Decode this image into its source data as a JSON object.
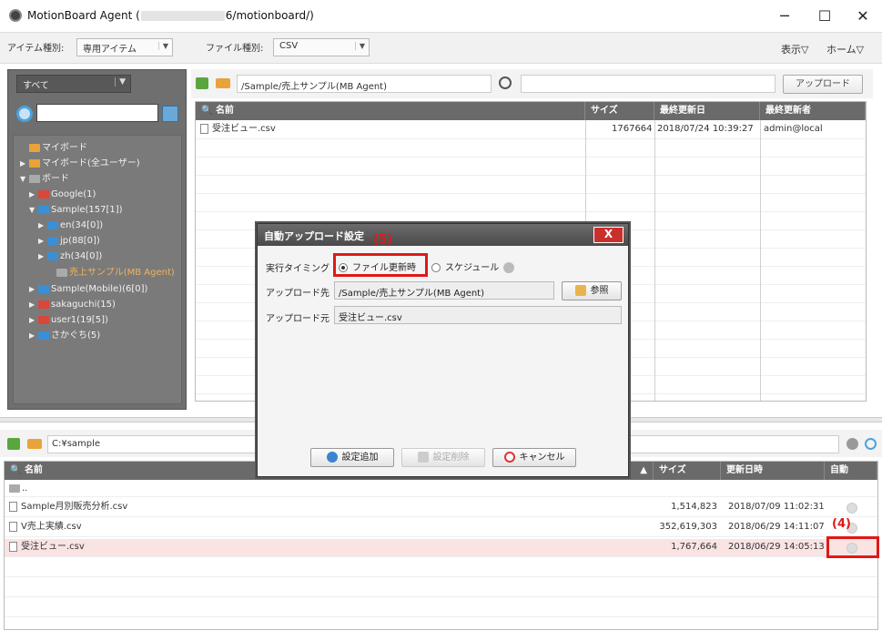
{
  "window": {
    "title_prefix": "MotionBoard Agent (",
    "title_suffix": "6/motionboard/)",
    "minimize": "─",
    "maximize": "☐",
    "close": "✕"
  },
  "toolbar": {
    "item_type_label": "アイテム種別:",
    "item_type_value": "専用アイテム",
    "file_type_label": "ファイル種別:",
    "file_type_value": "CSV",
    "view_label": "表示▽",
    "home_label": "ホーム▽"
  },
  "left": {
    "filter_value": "すべて",
    "tree": [
      {
        "label": "マイボード",
        "folder": "orange",
        "exp": ""
      },
      {
        "label": "マイボード(全ユーザー)",
        "folder": "orange",
        "exp": "▶"
      },
      {
        "label": "ボード",
        "folder": "gray",
        "exp": "▼"
      },
      {
        "label": "Google(1)",
        "folder": "red",
        "exp": "▶"
      },
      {
        "label": "Sample(157[1])",
        "folder": "blue",
        "exp": "▼"
      },
      {
        "label": "en(34[0])",
        "folder": "blue",
        "exp": "▶"
      },
      {
        "label": "jp(88[0])",
        "folder": "blue",
        "exp": "▶"
      },
      {
        "label": "zh(34[0])",
        "folder": "blue",
        "exp": "▶"
      },
      {
        "label": "売上サンプル(MB Agent)",
        "folder": "gray",
        "exp": "",
        "selected": true
      },
      {
        "label": "Sample(Mobile)(6[0])",
        "folder": "blue",
        "exp": "▶"
      },
      {
        "label": "sakaguchi(15)",
        "folder": "red",
        "exp": "▶"
      },
      {
        "label": "user1(19[5])",
        "folder": "red",
        "exp": "▶"
      },
      {
        "label": "さかぐち(5)",
        "folder": "blue",
        "exp": "▶"
      }
    ]
  },
  "upper": {
    "path": "/Sample/売上サンプル(MB Agent)",
    "upload_label": "アップロード",
    "headers": {
      "name": "名前",
      "size": "サイズ",
      "updated": "最終更新日",
      "updater": "最終更新者"
    },
    "rows": [
      {
        "name": "受注ビュー.csv",
        "size": "1767664",
        "updated": "2018/07/24 10:39:27",
        "updater": "admin@local"
      }
    ]
  },
  "dialog": {
    "title": "自動アップロード設定",
    "close": "X",
    "timing_label": "実行タイミング",
    "opt_file_update": "ファイル更新時",
    "opt_schedule": "スケジュール",
    "dest_label": "アップロード先",
    "dest_value": "/Sample/売上サンプル(MB Agent)",
    "browse_label": "参照",
    "src_label": "アップロード元",
    "src_value": "受注ビュー.csv",
    "add_label": "設定追加",
    "delete_label": "設定削除",
    "cancel_label": "キャンセル"
  },
  "lower": {
    "path": "C:¥sample",
    "headers": {
      "name": "名前",
      "size": "サイズ",
      "updated": "更新日時",
      "auto": "自動"
    },
    "parent": "..",
    "rows": [
      {
        "name": "Sample月別販売分析.csv",
        "size": "1,514,823",
        "updated": "2018/07/09 11:02:31"
      },
      {
        "name": "V売上実績.csv",
        "size": "352,619,303",
        "updated": "2018/06/29 14:11:07"
      },
      {
        "name": "受注ビュー.csv",
        "size": "1,767,664",
        "updated": "2018/06/29 14:05:13"
      }
    ]
  },
  "annotations": {
    "a4": "(4)",
    "a5": "(5)"
  },
  "colors": {
    "highlight": "#e01818",
    "panel_dark": "#6f6f6f",
    "accent_blue": "#4aa3df"
  }
}
